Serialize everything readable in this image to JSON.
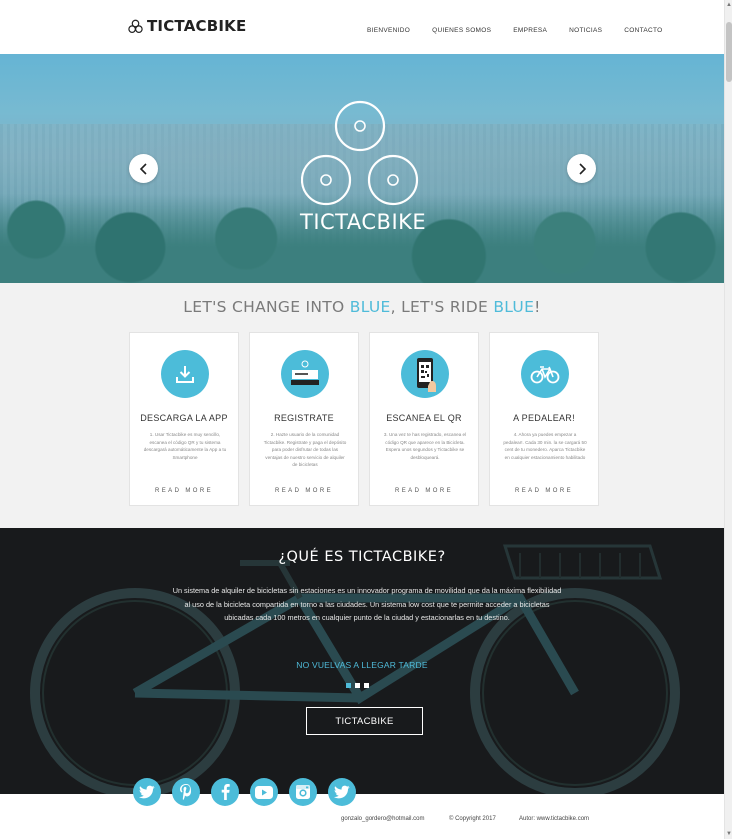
{
  "header": {
    "brand": "TICTACBIKE",
    "nav": [
      "BIENVENIDO",
      "QUIENES SOMOS",
      "EMPRESA",
      "NOTICIAS",
      "CONTACTO"
    ]
  },
  "hero": {
    "title": "TICTACBIKE"
  },
  "tagline": {
    "part1": "LET'S CHANGE INTO ",
    "blue1": "BLUE",
    "part2": ", LET'S RIDE ",
    "blue2": "BLUE",
    "part3": "!"
  },
  "cards": [
    {
      "icon": "download-icon",
      "title": "DESCARGA LA APP",
      "text": "1. Usar Tictacbike es muy sencillo, escanea el código QR y tu sistema descargará automáticamente la App a tu Smartphone",
      "more": "READ MORE"
    },
    {
      "icon": "register-icon",
      "title": "REGISTRATE",
      "text": "2. Hazte usuario de la comunidad Tictacbike. Registrate y paga el depósito para poder disfrutar de todas las ventajas de nuestro servicio de alquiler de bicicletas",
      "more": "READ MORE"
    },
    {
      "icon": "qr-phone-icon",
      "title": "ESCANEA EL QR",
      "text": "3. Una vez te has registrado, escanea el código QR que aparece en la Bicicleta. Espera unos segundos y Tictacbike se desbloqueará.",
      "more": "READ MORE"
    },
    {
      "icon": "bicycle-icon",
      "title": "A PEDALEAR!",
      "text": "4. Ahora ya puedes empezar a pedalear!. Cada 30 min. la se cargará 50 cent de tu monedero. Aparca Tictacbike en cualquier estacionamiento habilitado",
      "more": "READ MORE"
    }
  ],
  "about": {
    "title": "¿QUÉ ES TICTACBIKE?",
    "text": "Un sistema de alquiler de bicicletas sin estaciones es un innovador programa de movilidad que da la máxima flexibilidad al uso de la bicicleta compartida en torno a las ciudades. Un sistema low cost que te permite acceder a bicicletas ubicadas cada 100 metros en cualquier punto de la ciudad y estacionarlas en tu destino.",
    "subtitle": "NO VUELVAS A LLEGAR TARDE",
    "button": "TICTACBIKE"
  },
  "social": [
    "twitter-icon",
    "pinterest-icon",
    "facebook-icon",
    "youtube-icon",
    "instagram-icon",
    "twitter-icon"
  ],
  "footer": {
    "email": "gonzalo_gordero@hotmail.com",
    "copyright": "© Copyright 2017",
    "author": "Autor:   www.tictacbike.com"
  },
  "colors": {
    "accent": "#4cbcd9",
    "dark": "#181a1c"
  }
}
